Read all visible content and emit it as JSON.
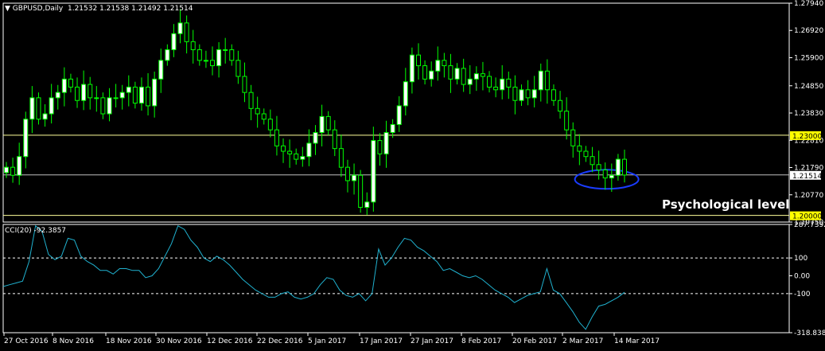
{
  "header": {
    "symbol": "GBPUSD,Daily",
    "ohlc": "1.21532 1.21538 1.21492 1.21514",
    "indicator_label": "CCI(20) -92.3857"
  },
  "colors": {
    "background": "#000000",
    "bull_candle": "#ffffff",
    "candle_outline": "#00ff00",
    "level_line": "#ffff99",
    "bid_line": "#c0c0c0",
    "cci_line": "#20b2d0",
    "ellipse": "#1a3cff",
    "label_bg_yellow": "#ffff00"
  },
  "chart_data": [
    {
      "type": "candlestick",
      "title": "GBPUSD,Daily",
      "ylim": [
        1.1975,
        1.2794
      ],
      "y_ticks": [
        "1.27940",
        "1.26920",
        "1.25900",
        "1.24850",
        "1.23830",
        "1.22810",
        "1.21790",
        "1.20770",
        "1.19750"
      ],
      "x_ticks": [
        "27 Oct 2016",
        "8 Nov 2016",
        "18 Nov 2016",
        "30 Nov 2016",
        "12 Dec 2016",
        "22 Dec 2016",
        "5 Jan 2017",
        "17 Jan 2017",
        "27 Jan 2017",
        "8 Feb 2017",
        "20 Feb 2017",
        "2 Mar 2017",
        "14 Mar 2017"
      ],
      "horizontal_levels": [
        {
          "label": "1.23000",
          "value": 1.23
        },
        {
          "label": "1.20000",
          "value": 1.2
        }
      ],
      "current_price": {
        "label": "1.21514",
        "value": 1.21514
      },
      "annotation": "Psychological level",
      "close_series": [
        1.218,
        1.215,
        1.222,
        1.236,
        1.244,
        1.236,
        1.238,
        1.244,
        1.246,
        1.251,
        1.248,
        1.243,
        1.249,
        1.244,
        1.244,
        1.238,
        1.244,
        1.244,
        1.246,
        1.248,
        1.242,
        1.248,
        1.241,
        1.251,
        1.258,
        1.262,
        1.268,
        1.272,
        1.265,
        1.262,
        1.258,
        1.258,
        1.256,
        1.262,
        1.262,
        1.258,
        1.252,
        1.246,
        1.24,
        1.238,
        1.236,
        1.232,
        1.226,
        1.224,
        1.223,
        1.221,
        1.222,
        1.227,
        1.231,
        1.237,
        1.232,
        1.225,
        1.218,
        1.213,
        1.215,
        1.203,
        1.205,
        1.228,
        1.223,
        1.231,
        1.234,
        1.241,
        1.25,
        1.26,
        1.256,
        1.251,
        1.254,
        1.258,
        1.256,
        1.251,
        1.255,
        1.249,
        1.251,
        1.253,
        1.252,
        1.248,
        1.247,
        1.251,
        1.248,
        1.243,
        1.247,
        1.244,
        1.247,
        1.254,
        1.247,
        1.243,
        1.239,
        1.232,
        1.226,
        1.224,
        1.222,
        1.219,
        1.217,
        1.214,
        1.215,
        1.221,
        1.2151
      ],
      "highlighted_range_x": [
        "2 Mar 2017",
        "14 Mar 2017"
      ]
    },
    {
      "type": "line",
      "title": "CCI(20) -92.3857",
      "ylim": [
        -318.8383,
        287.7392
      ],
      "y_ticks": [
        "287.7392",
        "100",
        "0.00",
        "-100",
        "-318.8383"
      ],
      "reference_levels": [
        100,
        -100
      ],
      "values": [
        -60,
        -50,
        -40,
        -30,
        80,
        280,
        250,
        120,
        90,
        110,
        210,
        200,
        110,
        80,
        60,
        30,
        30,
        10,
        40,
        40,
        30,
        30,
        -10,
        0,
        40,
        110,
        180,
        280,
        260,
        200,
        160,
        100,
        80,
        110,
        90,
        60,
        20,
        -20,
        -50,
        -80,
        -100,
        -120,
        -120,
        -100,
        -90,
        -120,
        -130,
        -120,
        -100,
        -50,
        -10,
        -20,
        -80,
        -110,
        -120,
        -100,
        -140,
        -100,
        150,
        60,
        100,
        160,
        210,
        200,
        160,
        140,
        110,
        80,
        30,
        40,
        20,
        0,
        -10,
        0,
        -20,
        -50,
        -80,
        -100,
        -120,
        -150,
        -130,
        -110,
        -100,
        -90,
        40,
        -80,
        -100,
        -150,
        -200,
        -260,
        -300,
        -230,
        -170,
        -160,
        -140,
        -120,
        -92.3857
      ]
    }
  ]
}
